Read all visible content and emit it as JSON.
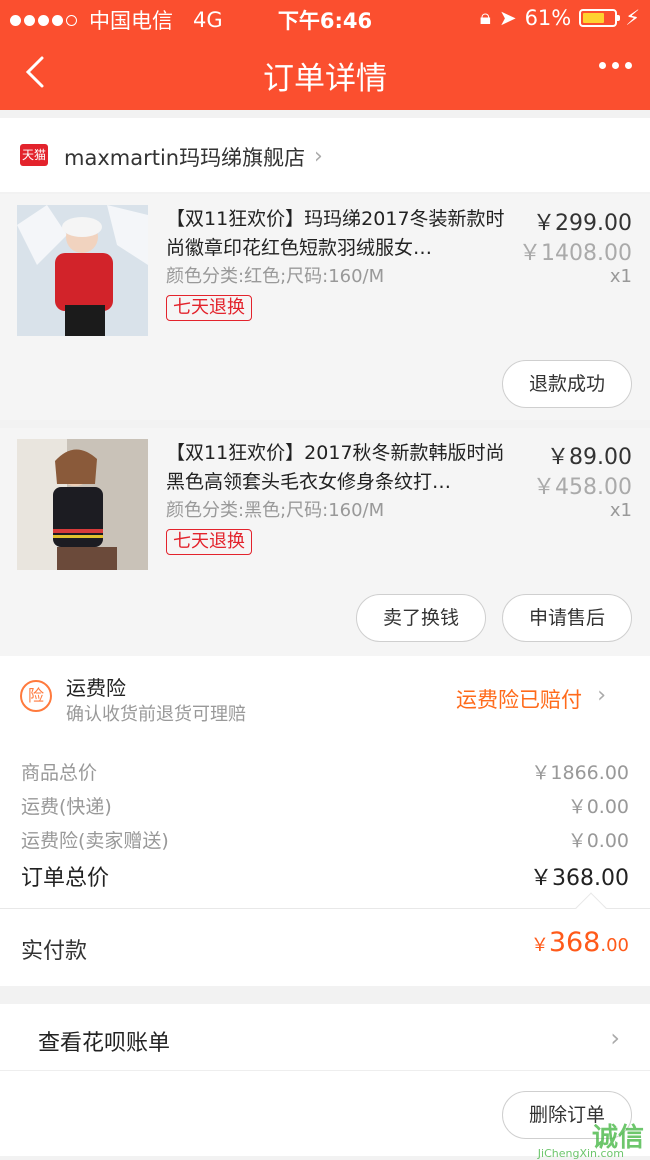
{
  "status_bar": {
    "carrier": "中国电信",
    "network": "4G",
    "time": "下午6:46",
    "battery_pct": "61%"
  },
  "nav": {
    "title": "订单详情"
  },
  "shop": {
    "badge": "天猫",
    "name": "maxmartin玛玛绨旗舰店"
  },
  "items": [
    {
      "title": "【双11狂欢价】玛玛绨2017冬装新款时尚徽章印花红色短款羽绒服女…",
      "sku": "颜色分类:红色;尺码:160/M",
      "tag": "七天退换",
      "price": "￥299.00",
      "orig_price": "￥1408.00",
      "qty": "x1",
      "buttons": [
        "退款成功"
      ]
    },
    {
      "title": "【双11狂欢价】2017秋冬新款韩版时尚黑色高领套头毛衣女修身条纹打…",
      "sku": "颜色分类:黑色;尺码:160/M",
      "tag": "七天退换",
      "price": "￥89.00",
      "orig_price": "￥458.00",
      "qty": "x1",
      "buttons": [
        "卖了换钱",
        "申请售后"
      ]
    }
  ],
  "insurance": {
    "icon_text": "险",
    "title": "运费险",
    "subtitle": "确认收货前退货可理赔",
    "status": "运费险已赔付"
  },
  "summary": {
    "goods_total_label": "商品总价",
    "goods_total": "￥1866.00",
    "shipping_label": "运费(快递)",
    "shipping": "￥0.00",
    "ins_label": "运费险(卖家赠送)",
    "ins": "￥0.00",
    "order_total_label": "订单总价",
    "order_total": "￥368.00"
  },
  "paid": {
    "label": "实付款",
    "currency": "￥",
    "int": "368",
    "dec": ".00"
  },
  "huabei": {
    "label": "查看花呗账单"
  },
  "bottom": {
    "delete": "删除订单"
  },
  "watermark": {
    "logo": "诚信",
    "url": "JiChengXin.com"
  },
  "colors": {
    "brand": "#fb4f2f",
    "accent": "#ff6a1a",
    "tmall": "#e3232c"
  }
}
